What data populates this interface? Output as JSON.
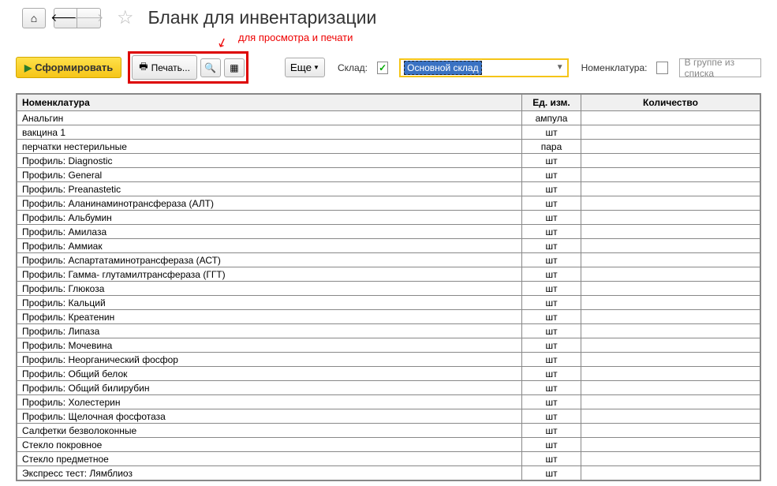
{
  "title": "Бланк для инвентаризации",
  "annotation": "для просмотра и печати",
  "toolbar": {
    "form_button": "Сформировать",
    "print_button": "Печать...",
    "more_button": "Еще",
    "warehouse_label": "Склад:",
    "warehouse_value": "Основной склад",
    "nomenclature_label": "Номенклатура:",
    "group_placeholder": "В группе из списка"
  },
  "table": {
    "headers": {
      "nomenclature": "Номенклатура",
      "unit": "Ед. изм.",
      "quantity": "Количество"
    },
    "rows": [
      {
        "name": "Анальгин",
        "unit": "ампула"
      },
      {
        "name": "вакцина 1",
        "unit": "шт"
      },
      {
        "name": "перчатки нестерильные",
        "unit": "пара"
      },
      {
        "name": "Профиль: Diagnostic",
        "unit": "шт"
      },
      {
        "name": "Профиль: General",
        "unit": "шт"
      },
      {
        "name": "Профиль: Preanastetic",
        "unit": "шт"
      },
      {
        "name": "Профиль: Аланинаминотрансфераза (АЛТ)",
        "unit": "шт"
      },
      {
        "name": "Профиль: Альбумин",
        "unit": "шт"
      },
      {
        "name": "Профиль: Амилаза",
        "unit": "шт"
      },
      {
        "name": "Профиль: Аммиак",
        "unit": "шт"
      },
      {
        "name": "Профиль: Аспартатаминотрансфераза (АСТ)",
        "unit": "шт"
      },
      {
        "name": "Профиль: Гамма- глутамилтрансфераза (ГГТ)",
        "unit": "шт"
      },
      {
        "name": "Профиль: Глюкоза",
        "unit": "шт"
      },
      {
        "name": "Профиль: Кальций",
        "unit": "шт"
      },
      {
        "name": "Профиль: Креатенин",
        "unit": "шт"
      },
      {
        "name": "Профиль: Липаза",
        "unit": "шт"
      },
      {
        "name": "Профиль: Мочевина",
        "unit": "шт"
      },
      {
        "name": "Профиль: Неорганический фосфор",
        "unit": "шт"
      },
      {
        "name": "Профиль: Общий белок",
        "unit": "шт"
      },
      {
        "name": "Профиль: Общий билирубин",
        "unit": "шт"
      },
      {
        "name": "Профиль: Холестерин",
        "unit": "шт"
      },
      {
        "name": "Профиль: Щелочная фосфотаза",
        "unit": "шт"
      },
      {
        "name": "Салфетки безволоконные",
        "unit": "шт"
      },
      {
        "name": "Стекло покровное",
        "unit": "шт"
      },
      {
        "name": "Стекло предметное",
        "unit": "шт"
      },
      {
        "name": "Экспресс тест: Лямблиоз",
        "unit": "шт"
      }
    ]
  }
}
